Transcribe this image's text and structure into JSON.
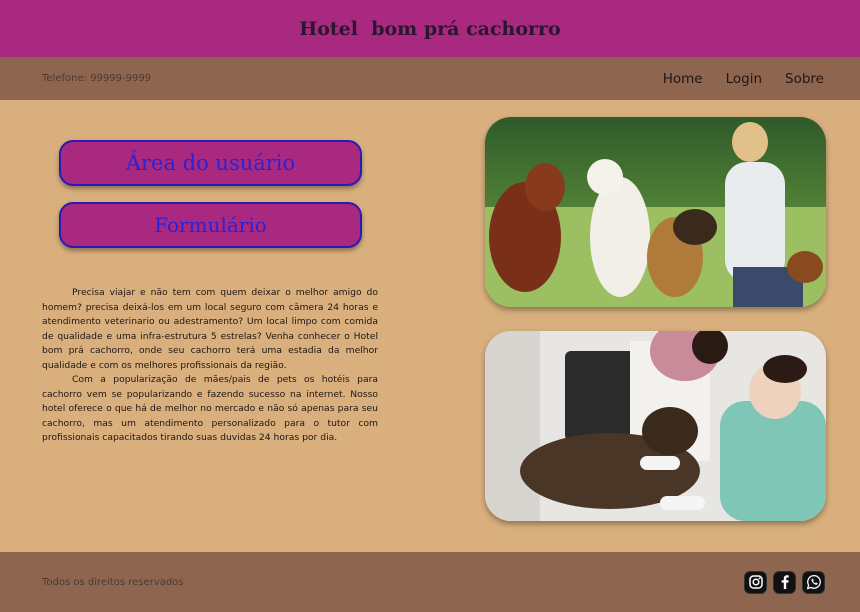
{
  "header": {
    "title": "Hotel  bom prá cachorro"
  },
  "nav": {
    "phone": "Telefone: 99999-9999",
    "links": [
      "Home",
      "Login",
      "Sobre"
    ]
  },
  "buttons": {
    "user_area": "Área do usuário",
    "form": "Formulário"
  },
  "intro": {
    "paragraphs": [
      "Precisa viajar e não tem com quem deixar o melhor amigo do homem? precisa deixá-los em um local seguro com câmera 24 horas e atendimento veterinario ou adestramento? Um local limpo com comida de qualidade e uma infra-estrutura 5 estrelas? Venha conhecer o Hotel bom prá cachorro, onde seu cachorro terá uma estadia da melhor qualidade e com os melhores profissionais da região.",
      "Com a popularização de mães/pais de pets os hotéis para cachorro vem se popularizando e fazendo sucesso na internet. Nosso hotel oferece o que há de melhor no mercado e não só apenas para seu cachorro, mas um atendimento personalizado para o tutor com profissionais capacitados tirando suas duvidas 24 horas por dia."
    ]
  },
  "photos": [
    {
      "icon": "dogs-playing-photo"
    },
    {
      "icon": "vet-care-photo"
    }
  ],
  "footer": {
    "rights": "Todos os direitos reservados",
    "social": [
      "instagram-icon",
      "facebook-icon",
      "whatsapp-icon"
    ]
  },
  "colors": {
    "header_bg": "#a8297f",
    "nav_bg": "#8e6650",
    "page_bg": "#d9af7e",
    "button_border": "#2a1bb5",
    "button_text": "#2b22d6"
  }
}
